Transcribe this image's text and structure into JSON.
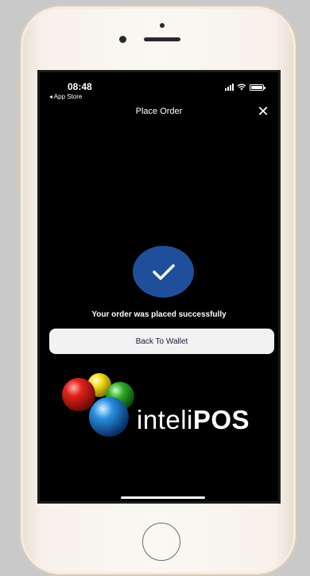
{
  "status_bar": {
    "time": "08:48",
    "back_label": "◂ App Store"
  },
  "header": {
    "title": "Place Order",
    "close_glyph": "✕"
  },
  "confirmation": {
    "message": "Your order was placed successfully",
    "button_label": "Back To Wallet"
  },
  "brand": {
    "name_light": "inteli",
    "name_bold": "POS"
  },
  "colors": {
    "accent_blue": "#1f4f9a",
    "screen_bg": "#000000",
    "button_bg": "#f2f2f2",
    "phone_frame": "#f7f1ea"
  }
}
